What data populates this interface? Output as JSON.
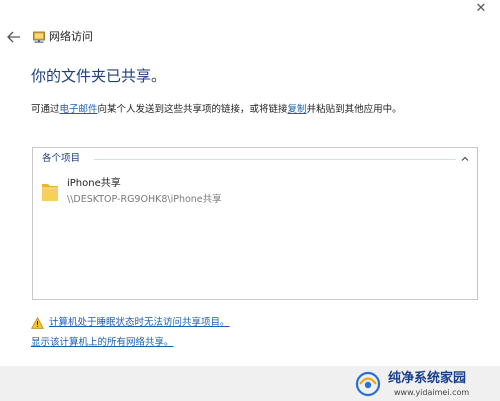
{
  "window": {
    "close_glyph": "✕"
  },
  "titlebar": {
    "back_icon": "back-arrow-icon",
    "app_icon": "network-folder-icon",
    "title": "网络访问"
  },
  "main": {
    "heading": "你的文件夹已共享。",
    "description": {
      "part1": "可通过",
      "email_link": "电子邮件",
      "part2": "向某个人发送到这些共享项的链接，或将链接",
      "copy_link": "复制",
      "part3": "并粘贴到其他应用中。"
    }
  },
  "items_panel": {
    "group_title": "各个项目",
    "items": [
      {
        "name": "iPhone共享",
        "path": "\\\\DESKTOP-RG9OHK8\\iPhone共享",
        "icon": "folder-icon"
      }
    ]
  },
  "links": {
    "sleep_warning": "计算机处于睡眠状态时无法访问共享项目。",
    "show_all": "显示该计算机上的所有网络共享。"
  },
  "watermark": {
    "text": "纯净系统家园",
    "url": "www.yidaimei.com"
  },
  "colors": {
    "heading": "#1e3f7a",
    "link": "#1a5fb4",
    "footer_bg": "#f0f0f0",
    "folder": "#f5c542"
  }
}
